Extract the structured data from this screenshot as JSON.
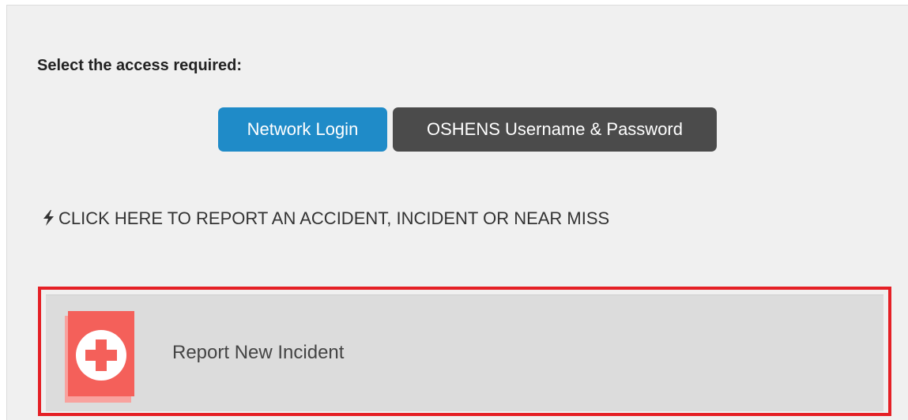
{
  "access": {
    "prompt": "Select the access required:",
    "network_login_label": "Network Login",
    "oshens_login_label": "OSHENS Username & Password"
  },
  "report_link": {
    "icon": "bolt-icon",
    "text": "CLICK HERE TO REPORT AN ACCIDENT, INCIDENT OR NEAR MISS"
  },
  "incident_tile": {
    "icon": "medical-plus-icon",
    "label": "Report New Incident"
  },
  "colors": {
    "primary_button": "#1f8bc8",
    "secondary_button": "#4b4b4b",
    "highlight_border": "#e52026",
    "icon_red": "#f4605a",
    "panel_background": "#f0f0f0"
  }
}
